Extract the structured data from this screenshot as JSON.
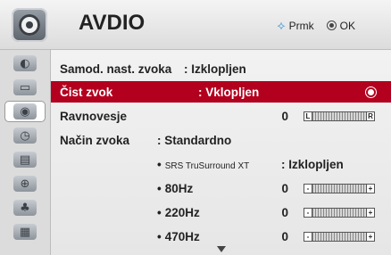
{
  "header": {
    "title": "AVDIO",
    "move_hint": "Prmk",
    "ok_hint": "OK"
  },
  "sidebar": {
    "items": [
      {
        "icon": "picture-icon"
      },
      {
        "icon": "tv-icon"
      },
      {
        "icon": "audio-icon",
        "active": true
      },
      {
        "icon": "clock-icon"
      },
      {
        "icon": "options-icon"
      },
      {
        "icon": "lock-icon"
      },
      {
        "icon": "input-icon"
      },
      {
        "icon": "media-icon"
      }
    ]
  },
  "menu": {
    "auto_volume": {
      "label": "Samod. nast. zvoka",
      "value": ": Izklopljen"
    },
    "clear_voice": {
      "label": "Čist zvok",
      "value": ": Vklopljen"
    },
    "balance": {
      "label": "Ravnovesje",
      "value": "0",
      "left": "L",
      "right": "R"
    },
    "sound_mode": {
      "label": "Način zvoka",
      "value": ": Standardno"
    },
    "srs": {
      "label": "SRS TruSurround XT",
      "value": ": Izklopljen"
    },
    "eq": [
      {
        "label": "80Hz",
        "value": "0"
      },
      {
        "label": "220Hz",
        "value": "0"
      },
      {
        "label": "470Hz",
        "value": "0"
      }
    ],
    "minus": "-",
    "plus": "+",
    "bullet": "•"
  }
}
